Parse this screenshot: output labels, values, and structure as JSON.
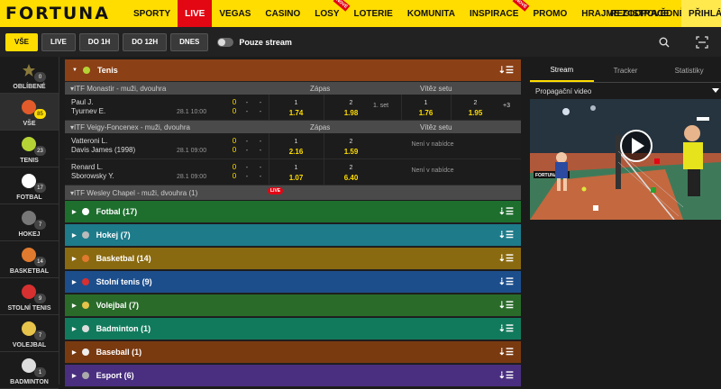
{
  "brand": {
    "logo": "FORTUNA",
    "accent": "#ffdd00",
    "live_red": "#e30613"
  },
  "topnav": {
    "items": [
      {
        "label": "SPORTY"
      },
      {
        "label": "LIVE",
        "active": true
      },
      {
        "label": "VEGAS"
      },
      {
        "label": "CASINO"
      },
      {
        "label": "LOSY",
        "badge": "NOVÉ"
      },
      {
        "label": "LOTERIE"
      },
      {
        "label": "KOMUNITA"
      },
      {
        "label": "INSPIRACE",
        "badge": "NOVÉ"
      },
      {
        "label": "PROMO"
      },
      {
        "label": "HRAJME ZODPOVĚDNĚ"
      }
    ],
    "register": "REGISTRACE",
    "login": "PŘIHLÁ"
  },
  "filters": {
    "buttons": [
      {
        "label": "VŠE",
        "active": true
      },
      {
        "label": "LIVE"
      },
      {
        "label": "DO 1H"
      },
      {
        "label": "DO 12H"
      },
      {
        "label": "DNES"
      }
    ],
    "stream_toggle": "Pouze stream"
  },
  "sidebar": {
    "items": [
      {
        "label": "OBLÍBENÉ",
        "count": "0",
        "icon": "star-icon",
        "color": "#8a7a3a"
      },
      {
        "label": "VŠE",
        "count": "85",
        "icon": "all-sports-icon",
        "color": "#e35b2a",
        "active": true,
        "highlight": true
      },
      {
        "label": "TENIS",
        "count": "23",
        "icon": "tennis-ball-icon",
        "color": "#b5d334"
      },
      {
        "label": "FOTBAL",
        "count": "17",
        "icon": "football-icon",
        "color": "#ffffff"
      },
      {
        "label": "HOKEJ",
        "count": "7",
        "icon": "hockey-icon",
        "color": "#777777"
      },
      {
        "label": "BASKETBAL",
        "count": "14",
        "icon": "basketball-icon",
        "color": "#e07a2e"
      },
      {
        "label": "STOLNÍ TENIS",
        "count": "9",
        "icon": "table-tennis-icon",
        "color": "#d73030"
      },
      {
        "label": "VOLEJBAL",
        "count": "7",
        "icon": "volleyball-icon",
        "color": "#e6c34a"
      },
      {
        "label": "BADMINTON",
        "count": "1",
        "icon": "badminton-icon",
        "color": "#dddddd"
      }
    ]
  },
  "tenis": {
    "header": "Tenis",
    "color": "#8b4016",
    "labels": {
      "zapas": "Zápas",
      "vitez_setu": "Vítěz setu",
      "not_offered": "Není v nabídce",
      "live": "LIVE"
    },
    "competitions": [
      {
        "name": "ITF Monastir - muži, dvouhra",
        "matches": [
          {
            "home": "Paul J.",
            "away": "Tyurnev E.",
            "time": "28.1 10:00",
            "score_home": "0",
            "score_away": "0",
            "odds": [
              {
                "label": "1",
                "value": "1.74"
              },
              {
                "label": "2",
                "value": "1.98"
              }
            ],
            "set_label": "1. set",
            "set_odds": [
              {
                "label": "1",
                "value": "1.76"
              },
              {
                "label": "2",
                "value": "1.95"
              }
            ],
            "more": "+3"
          }
        ]
      },
      {
        "name": "ITF Veigy-Foncenex - muži, dvouhra",
        "matches": [
          {
            "home": "Vatteroni L.",
            "away": "Davis James (1998)",
            "time": "28.1 09:00",
            "score_home": "0",
            "score_away": "0",
            "odds": [
              {
                "label": "1",
                "value": "2.16"
              },
              {
                "label": "2",
                "value": "1.59"
              }
            ]
          },
          {
            "home": "Renard L.",
            "away": "Sborowsky Y.",
            "time": "28.1 09:00",
            "score_home": "0",
            "score_away": "0",
            "odds": [
              {
                "label": "1",
                "value": "1.07"
              },
              {
                "label": "2",
                "value": "6.40"
              }
            ]
          }
        ]
      },
      {
        "name": "ITF Wesley Chapel - muži, dvouhra (1)"
      }
    ]
  },
  "sports": [
    {
      "label": "Fotbal (17)",
      "color": "#1e6e2e",
      "icon": "football-icon",
      "ball": "#ffffff"
    },
    {
      "label": "Hokej (7)",
      "color": "#1e7b8a",
      "icon": "hockey-icon",
      "ball": "#bbbbbb"
    },
    {
      "label": "Basketbal (14)",
      "color": "#8a6a10",
      "icon": "basketball-icon",
      "ball": "#e07a2e"
    },
    {
      "label": "Stolní tenis (9)",
      "color": "#1d4e8c",
      "icon": "table-tennis-icon",
      "ball": "#d73030"
    },
    {
      "label": "Volejbal (7)",
      "color": "#2a6b2a",
      "icon": "volleyball-icon",
      "ball": "#e6c34a"
    },
    {
      "label": "Badminton (1)",
      "color": "#127a5c",
      "icon": "badminton-icon",
      "ball": "#dddddd"
    },
    {
      "label": "Baseball (1)",
      "color": "#7a3a10",
      "icon": "baseball-icon",
      "ball": "#eeeeee"
    },
    {
      "label": "Esport (6)",
      "color": "#4a2f80",
      "icon": "esport-icon",
      "ball": "#aaaaaa"
    }
  ],
  "right_panel": {
    "tabs": [
      {
        "label": "Stream",
        "active": true
      },
      {
        "label": "Tracker"
      },
      {
        "label": "Statistiky"
      }
    ],
    "promo_label": "Propagační video",
    "video_brand": "FORTUNA"
  }
}
